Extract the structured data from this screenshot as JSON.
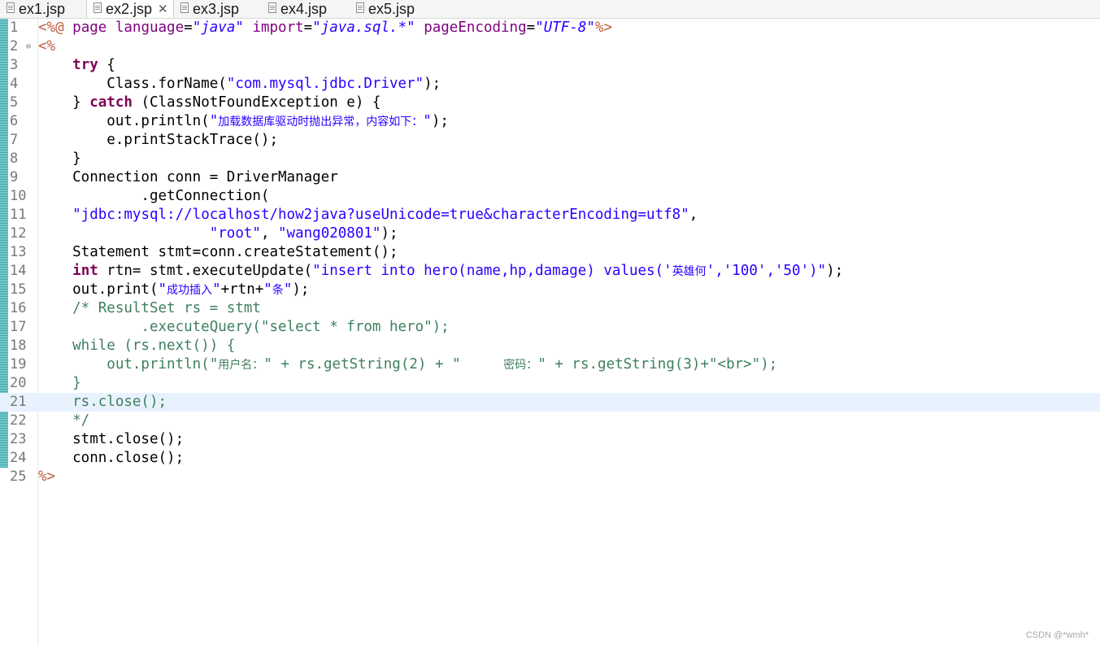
{
  "tabs": [
    {
      "label": "ex1.jsp",
      "active": false
    },
    {
      "label": "ex2.jsp",
      "active": true
    },
    {
      "label": "ex3.jsp",
      "active": false
    },
    {
      "label": "ex4.jsp",
      "active": false
    },
    {
      "label": "ex5.jsp",
      "active": false
    }
  ],
  "close_symbol": "✕",
  "current_line": 21,
  "lines": [
    {
      "n": "1",
      "segs": [
        [
          "jsp",
          "<%@ "
        ],
        [
          "attr",
          "page "
        ],
        [
          "attr",
          "language"
        ],
        [
          "txt",
          "="
        ],
        [
          "aval",
          "\"java\""
        ],
        [
          "txt",
          " "
        ],
        [
          "attr",
          "import"
        ],
        [
          "txt",
          "="
        ],
        [
          "aval",
          "\"java.sql.*\""
        ],
        [
          "txt",
          " "
        ],
        [
          "attr",
          "pageEncoding"
        ],
        [
          "txt",
          "="
        ],
        [
          "aval",
          "\"UTF-8\""
        ],
        [
          "jsp",
          "%>"
        ]
      ]
    },
    {
      "n": "2",
      "fold": true,
      "segs": [
        [
          "jsp",
          "<%"
        ]
      ]
    },
    {
      "n": "3",
      "segs": [
        [
          "txt",
          "    "
        ],
        [
          "kw",
          "try"
        ],
        [
          "txt",
          " {"
        ]
      ]
    },
    {
      "n": "4",
      "segs": [
        [
          "txt",
          "        Class.forName("
        ],
        [
          "str",
          "\"com.mysql.jdbc.Driver\""
        ],
        [
          "txt",
          ");"
        ]
      ]
    },
    {
      "n": "5",
      "segs": [
        [
          "txt",
          "    } "
        ],
        [
          "kw",
          "catch"
        ],
        [
          "txt",
          " (ClassNotFoundException e) {"
        ]
      ]
    },
    {
      "n": "6",
      "segs": [
        [
          "txt",
          "        out.println("
        ],
        [
          "str",
          "\""
        ],
        [
          "strcjk",
          "加载数据库驱动时抛出异常，内容如下："
        ],
        [
          "str",
          "\""
        ],
        [
          "txt",
          ");"
        ]
      ]
    },
    {
      "n": "7",
      "segs": [
        [
          "txt",
          "        e.printStackTrace();"
        ]
      ]
    },
    {
      "n": "8",
      "segs": [
        [
          "txt",
          "    }"
        ]
      ]
    },
    {
      "n": "9",
      "segs": [
        [
          "txt",
          "    Connection conn = DriverManager"
        ]
      ]
    },
    {
      "n": "10",
      "segs": [
        [
          "txt",
          "            .getConnection("
        ]
      ]
    },
    {
      "n": "11",
      "segs": [
        [
          "txt",
          "    "
        ],
        [
          "str",
          "\"jdbc:mysql://localhost/how2java?useUnicode=true&characterEncoding=utf8\""
        ],
        [
          "txt",
          ","
        ]
      ]
    },
    {
      "n": "12",
      "segs": [
        [
          "txt",
          "                    "
        ],
        [
          "str",
          "\"root\""
        ],
        [
          "txt",
          ", "
        ],
        [
          "str",
          "\"wang020801\""
        ],
        [
          "txt",
          ");"
        ]
      ]
    },
    {
      "n": "13",
      "segs": [
        [
          "txt",
          "    Statement stmt=conn.createStatement();"
        ]
      ]
    },
    {
      "n": "14",
      "segs": [
        [
          "txt",
          "    "
        ],
        [
          "kw",
          "int"
        ],
        [
          "txt",
          " rtn= stmt.executeUpdate("
        ],
        [
          "str",
          "\"insert into hero(name,hp,damage) values('"
        ],
        [
          "strcjk",
          "英雄何"
        ],
        [
          "str",
          "','100','50')\""
        ],
        [
          "txt",
          ");"
        ]
      ]
    },
    {
      "n": "15",
      "segs": [
        [
          "txt",
          "    out.print("
        ],
        [
          "str",
          "\""
        ],
        [
          "strcjk",
          "成功插入"
        ],
        [
          "str",
          "\""
        ],
        [
          "txt",
          "+rtn+"
        ],
        [
          "str",
          "\""
        ],
        [
          "strcjk",
          "条"
        ],
        [
          "str",
          "\""
        ],
        [
          "txt",
          ");"
        ]
      ]
    },
    {
      "n": "16",
      "segs": [
        [
          "cmt",
          "    /* ResultSet rs = stmt"
        ]
      ]
    },
    {
      "n": "17",
      "segs": [
        [
          "cmt",
          "            .executeQuery(\"select * from hero\");"
        ]
      ]
    },
    {
      "n": "18",
      "segs": [
        [
          "cmt",
          "    while (rs.next()) {"
        ]
      ]
    },
    {
      "n": "19",
      "segs": [
        [
          "cmt",
          "        out.println(\""
        ],
        [
          "cmtcjk",
          "用户名："
        ],
        [
          "cmt",
          "\" + rs.getString(2) + \"     "
        ],
        [
          "cmtcjk",
          "密码："
        ],
        [
          "cmt",
          "\" + rs.getString(3)+\"<br>\");"
        ]
      ]
    },
    {
      "n": "20",
      "segs": [
        [
          "cmt",
          "    }"
        ]
      ]
    },
    {
      "n": "21",
      "segs": [
        [
          "cmt",
          "    rs.close();"
        ]
      ]
    },
    {
      "n": "22",
      "segs": [
        [
          "cmt",
          "    */"
        ]
      ]
    },
    {
      "n": "23",
      "segs": [
        [
          "txt",
          "    stmt.close();"
        ]
      ]
    },
    {
      "n": "24",
      "segs": [
        [
          "txt",
          "    conn.close();"
        ]
      ]
    },
    {
      "n": "25",
      "segs": [
        [
          "jsp",
          "%>"
        ]
      ]
    }
  ],
  "watermark": "CSDN @*wmh*"
}
